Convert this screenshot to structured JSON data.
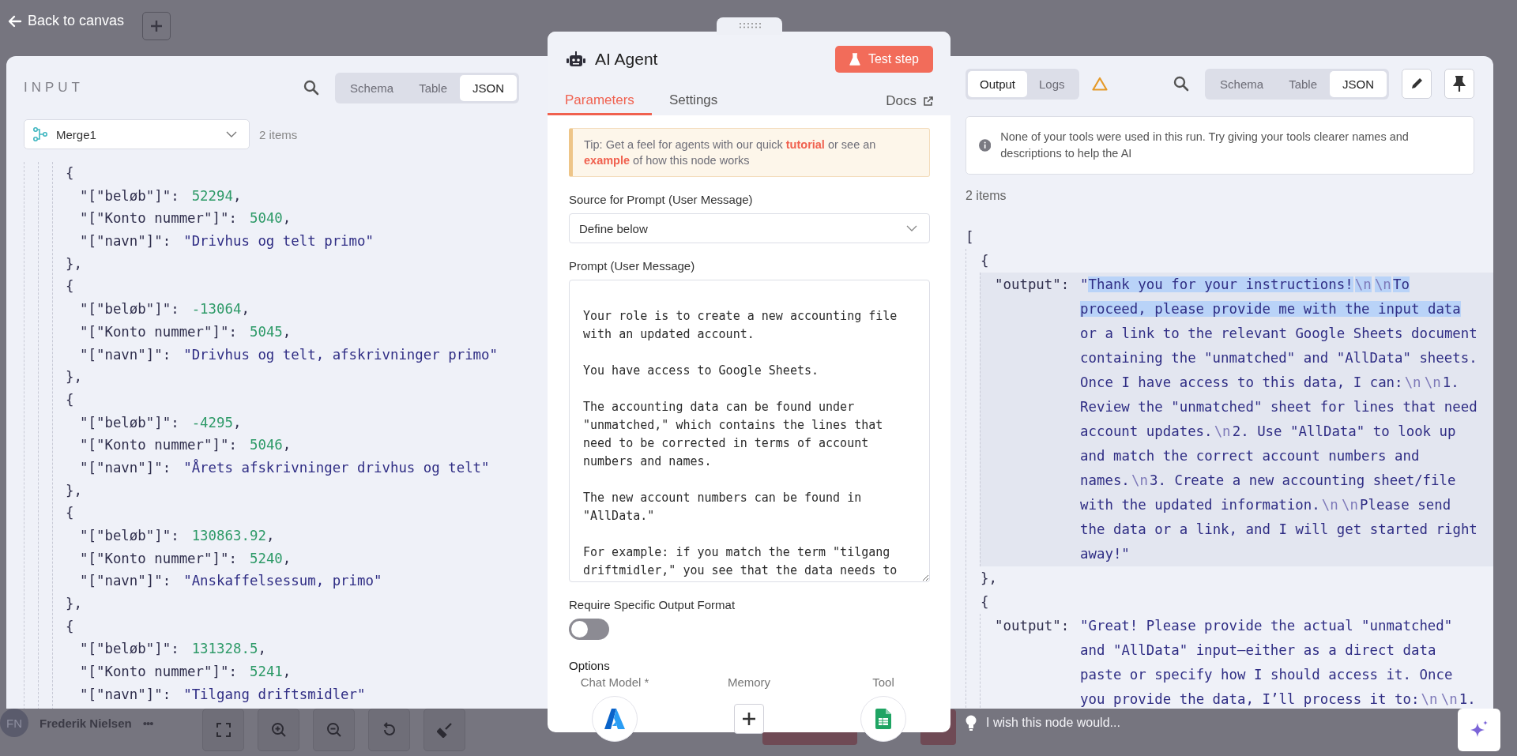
{
  "top_bar": {
    "back_label": "Back to canvas"
  },
  "input_panel": {
    "title": "INPUT",
    "view_tabs": [
      {
        "label": "Schema",
        "selected": false
      },
      {
        "label": "Table",
        "selected": false
      },
      {
        "label": "JSON",
        "selected": true
      }
    ],
    "source_node": "Merge1",
    "item_count": "2 items",
    "lines": [
      {
        "kind": "open",
        "text": "{"
      },
      {
        "kind": "number",
        "key": "\"[\"beløb\"]\":",
        "value": "52294",
        "suffix": ","
      },
      {
        "kind": "number",
        "key": "\"[\"Konto nummer\"]\":",
        "value": "5040",
        "suffix": ","
      },
      {
        "kind": "string",
        "key": "\"[\"navn\"]\":",
        "value": "\"Drivhus og telt primo\""
      },
      {
        "kind": "close",
        "text": "},"
      },
      {
        "kind": "open",
        "text": "{"
      },
      {
        "kind": "number",
        "key": "\"[\"beløb\"]\":",
        "value": "-13064",
        "suffix": ","
      },
      {
        "kind": "number",
        "key": "\"[\"Konto nummer\"]\":",
        "value": "5045",
        "suffix": ","
      },
      {
        "kind": "string",
        "key": "\"[\"navn\"]\":",
        "value": "\"Drivhus og telt, afskrivninger primo\""
      },
      {
        "kind": "close",
        "text": "},"
      },
      {
        "kind": "open",
        "text": "{"
      },
      {
        "kind": "number",
        "key": "\"[\"beløb\"]\":",
        "value": "-4295",
        "suffix": ","
      },
      {
        "kind": "number",
        "key": "\"[\"Konto nummer\"]\":",
        "value": "5046",
        "suffix": ","
      },
      {
        "kind": "string",
        "key": "\"[\"navn\"]\":",
        "value": "\"Årets afskrivninger drivhus og telt\""
      },
      {
        "kind": "close",
        "text": "},"
      },
      {
        "kind": "open",
        "text": "{"
      },
      {
        "kind": "number",
        "key": "\"[\"beløb\"]\":",
        "value": "130863.92",
        "suffix": ","
      },
      {
        "kind": "number",
        "key": "\"[\"Konto nummer\"]\":",
        "value": "5240",
        "suffix": ","
      },
      {
        "kind": "string",
        "key": "\"[\"navn\"]\":",
        "value": "\"Anskaffelsessum, primo\""
      },
      {
        "kind": "close",
        "text": "},"
      },
      {
        "kind": "open",
        "text": "{"
      },
      {
        "kind": "number",
        "key": "\"[\"beløb\"]\":",
        "value": "131328.5",
        "suffix": ","
      },
      {
        "kind": "number",
        "key": "\"[\"Konto nummer\"]\":",
        "value": "5241",
        "suffix": ","
      },
      {
        "kind": "string",
        "key": "\"[\"navn\"]\":",
        "value": "\"Tilgang driftsmidler\""
      }
    ]
  },
  "node_panel": {
    "title": "AI Agent",
    "test_button": "Test step",
    "tabs": [
      {
        "label": "Parameters",
        "selected": true
      },
      {
        "label": "Settings",
        "selected": false
      }
    ],
    "docs_link": "Docs",
    "tip": [
      {
        "kind": "text",
        "text": "Tip: Get a feel for agents with our quick "
      },
      {
        "kind": "link",
        "text": "tutorial"
      },
      {
        "kind": "text",
        "text": " or see an "
      },
      {
        "kind": "link",
        "text": "example"
      },
      {
        "kind": "text",
        "text": " of how this node works"
      }
    ],
    "fields": [
      {
        "kind": "select",
        "label": "Source for Prompt (User Message)",
        "value": "Define below"
      },
      {
        "kind": "textarea",
        "label": "Prompt (User Message)",
        "value": "\nYour role is to create a new accounting file with an updated account.\n\nYou have access to Google Sheets.\n\nThe accounting data can be found under \"unmatched,\" which contains the lines that need to be corrected in terms of account numbers and names.\n\nThe new account numbers can be found in \"AllData.\"\n\nFor example: if you match the term \"tilgang driftmidler,\" you see that the data needs to"
      },
      {
        "kind": "toggle",
        "label": "Require Specific Output Format",
        "on": false
      }
    ],
    "options_heading": "Options",
    "connectors": [
      {
        "kind": "model",
        "label": "Chat Model *"
      },
      {
        "kind": "add",
        "label": "Memory"
      },
      {
        "kind": "tool",
        "label": "Tool"
      }
    ]
  },
  "output_panel": {
    "mode_tabs": [
      {
        "label": "Output",
        "selected": true
      },
      {
        "label": "Logs",
        "selected": false
      }
    ],
    "view_tabs": [
      {
        "label": "Schema",
        "selected": false
      },
      {
        "label": "Table",
        "selected": false
      },
      {
        "label": "JSON",
        "selected": true
      }
    ],
    "notice": "None of your tools were used in this run. Try giving your tools clearer names and descriptions to help the AI",
    "item_count": "2 items",
    "open_bracket": "[",
    "items": [
      {
        "open": "{",
        "key": "\"output\":",
        "close": "},",
        "highlighted": true,
        "segments": [
          {
            "kind": "text",
            "text": "\"",
            "selected": false
          },
          {
            "kind": "text",
            "text": "Thank you for your instructions!",
            "selected": true
          },
          {
            "kind": "escape",
            "text": "\\n",
            "selected": true
          },
          {
            "kind": "escape",
            "text": "\\n",
            "selected": true
          },
          {
            "kind": "text",
            "text": "To proceed, please provide me with the input data",
            "selected": true
          },
          {
            "kind": "text",
            "text": " or a link to the relevant Google Sheets document containing the \"unmatched\" and \"AllData\" sheets. Once I have access to this data, I can:",
            "selected": false
          },
          {
            "kind": "escape",
            "text": "\\n",
            "selected": false
          },
          {
            "kind": "escape",
            "text": "\\n",
            "selected": false
          },
          {
            "kind": "text",
            "text": "1. Review the \"unmatched\" sheet for lines that need account updates.",
            "selected": false
          },
          {
            "kind": "escape",
            "text": "\\n",
            "selected": false
          },
          {
            "kind": "text",
            "text": "2. Use \"AllData\" to look up and match the correct account numbers and names.",
            "selected": false
          },
          {
            "kind": "escape",
            "text": "\\n",
            "selected": false
          },
          {
            "kind": "text",
            "text": "3. Create a new accounting sheet/file with the updated information.",
            "selected": false
          },
          {
            "kind": "escape",
            "text": "\\n",
            "selected": false
          },
          {
            "kind": "escape",
            "text": "\\n",
            "selected": false
          },
          {
            "kind": "text",
            "text": "Please send the data or a link, and I will get started right away!\"",
            "selected": false
          }
        ]
      },
      {
        "open": "{",
        "key": "\"output\":",
        "highlighted": false,
        "segments": [
          {
            "kind": "text",
            "text": "\"Great! Please provide the actual \"unmatched\" and \"AllData\" input—either as a direct data paste or specify how I should access it. Once you provide the data, I’ll process it to:",
            "selected": false
          },
          {
            "kind": "escape",
            "text": "\\n",
            "selected": false
          },
          {
            "kind": "escape",
            "text": "\\n",
            "selected": false
          },
          {
            "kind": "text",
            "text": "1.",
            "selected": false
          }
        ]
      }
    ]
  },
  "bottom_bar": {
    "user_initials": "FN",
    "user_name": "Frederik Nielsen",
    "more": "•••",
    "feedback_placeholder": "I wish this node would..."
  }
}
